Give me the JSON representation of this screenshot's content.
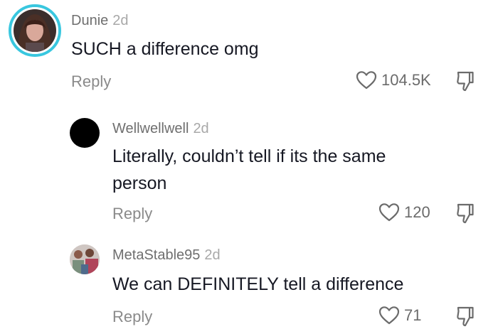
{
  "comments": [
    {
      "username": "Dunie",
      "time": "2d",
      "text": [
        "SUCH a difference omg"
      ],
      "reply_label": "Reply",
      "likes": "104.5K",
      "avatar": "profile-photo",
      "story_ring_color": "#39c7df"
    },
    {
      "username": "Wellwellwell",
      "time": "2d",
      "text": [
        "Literally, couldn’t tell if its the same",
        "person"
      ],
      "reply_label": "Reply",
      "likes": "120",
      "avatar": "black-circle"
    },
    {
      "username": "MetaStable95",
      "time": "2d",
      "text": [
        "We can DEFINITELY tell a difference"
      ],
      "reply_label": "Reply",
      "likes": "71",
      "avatar": "profile-photo"
    }
  ],
  "icons": {
    "like": "heart-outline-icon",
    "dislike": "thumbs-down-icon"
  }
}
